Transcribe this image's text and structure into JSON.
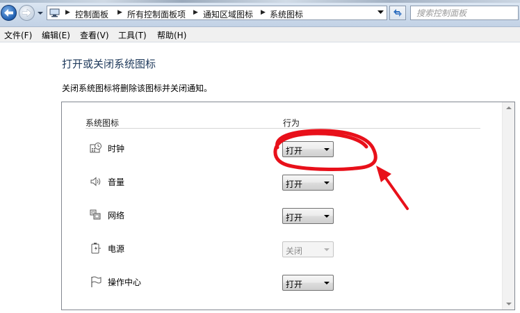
{
  "window": {
    "breadcrumb": [
      "控制面板",
      "所有控制面板项",
      "通知区域图标",
      "系统图标"
    ],
    "search_placeholder": "搜索控制面板"
  },
  "menubar": {
    "items": [
      "文件(F)",
      "编辑(E)",
      "查看(V)",
      "工具(T)",
      "帮助(H)"
    ]
  },
  "page": {
    "title": "打开或关闭系统图标",
    "description": "关闭系统图标将删除该图标并关闭通知。"
  },
  "table": {
    "col_name": "系统图标",
    "col_action": "行为",
    "rows": [
      {
        "label": "时钟",
        "value": "打开",
        "enabled": true,
        "icon": "clock-icon"
      },
      {
        "label": "音量",
        "value": "打开",
        "enabled": true,
        "icon": "volume-icon"
      },
      {
        "label": "网络",
        "value": "打开",
        "enabled": true,
        "icon": "network-icon"
      },
      {
        "label": "电源",
        "value": "关闭",
        "enabled": false,
        "icon": "power-icon"
      },
      {
        "label": "操作中心",
        "value": "打开",
        "enabled": true,
        "icon": "flag-icon"
      }
    ]
  },
  "annotation": {
    "color": "#e8101a"
  }
}
